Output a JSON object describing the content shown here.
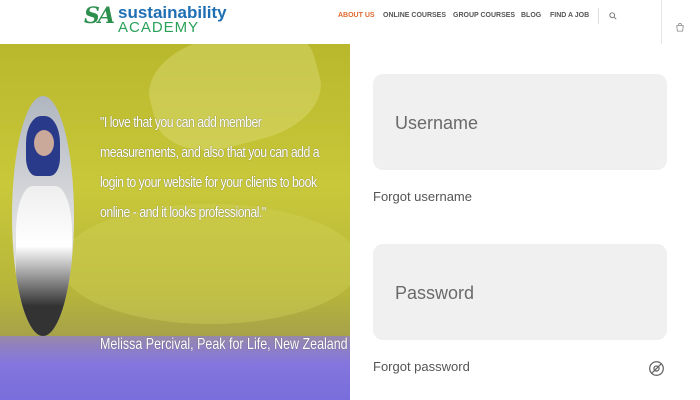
{
  "logo": {
    "mark": "SA",
    "line1": "sustainability",
    "line2": "ACADEMY"
  },
  "nav": {
    "items": [
      {
        "label": "ABOUT US",
        "active": true
      },
      {
        "label": "ONLINE COURSES",
        "active": false
      },
      {
        "label": "GROUP COURSES",
        "active": false
      },
      {
        "label": "BLOG",
        "active": false
      },
      {
        "label": "FIND A JOB",
        "active": false
      }
    ]
  },
  "hero": {
    "quote": "\"I love that you can add member measurements, and also that you can add a login to your website for your clients to book online - and it looks professional.\"",
    "author": "Melissa Percival, Peak for Life, New Zealand"
  },
  "login": {
    "username_placeholder": "Username",
    "forgot_username": "Forgot username",
    "password_placeholder": "Password",
    "forgot_password": "Forgot password"
  },
  "colors": {
    "accent": "#e0682c",
    "brand_blue": "#1f6fb5",
    "brand_green": "#2aa15a"
  }
}
